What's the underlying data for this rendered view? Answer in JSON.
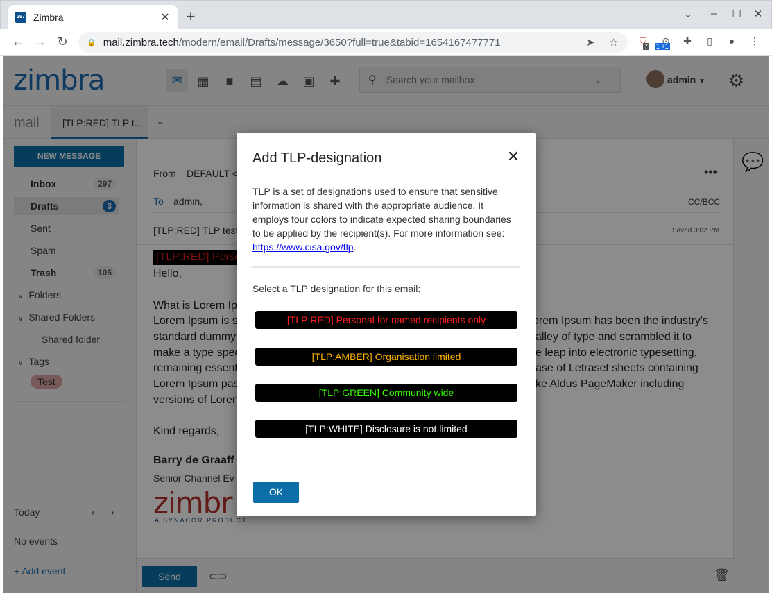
{
  "browser": {
    "tab_title": "Zimbra",
    "url_host": "mail.zimbra.tech",
    "url_path": "/modern/email/Drafts/message/3650?full=true&tabid=1654167477771",
    "ext_badge_1": "7",
    "ext_badge_2": "1 +1",
    "favicon_text": "297"
  },
  "app": {
    "logo": "zimbra",
    "search_placeholder": "Search your mailbox",
    "username": "admin",
    "tab_mail": "mail",
    "tab_draft": "[TLP:RED] TLP t..."
  },
  "sidebar": {
    "new_message": "NEW MESSAGE",
    "folders": [
      {
        "label": "Inbox",
        "count": "297",
        "bold": true
      },
      {
        "label": "Drafts",
        "count": "3",
        "bold": true
      },
      {
        "label": "Sent",
        "count": ""
      },
      {
        "label": "Spam",
        "count": ""
      },
      {
        "label": "Trash",
        "count": "105",
        "bold": true
      }
    ],
    "folders_group": "Folders",
    "shared_group": "Shared Folders",
    "shared_folder": "Shared folder",
    "tags_group": "Tags",
    "tag": "Test",
    "today": "Today",
    "no_events": "No events",
    "add_event": "Add event"
  },
  "compose": {
    "from_label": "From",
    "from_value": "DEFAULT <a",
    "to_label": "To",
    "to_value": "admin,",
    "ccbcc": "CC/BCC",
    "subject": "[TLP:RED] TLP test",
    "saved": "Saved 3:02 PM",
    "tlp_tag": "[TLP:RED] Perso",
    "greeting": "Hello,",
    "line1": "What is Lorem Ip",
    "para_left": [
      "Lorem Ipsum is s",
      "standard dummy",
      "make a type spec",
      "remaining essent",
      "Lorem Ipsum pas",
      "versions of Loren"
    ],
    "para_right": [
      "orem Ipsum has been the industry's",
      "alley of type and scrambled it to",
      "e leap into electronic typesetting,",
      "ase of Letraset sheets containing",
      "ke Aldus PageMaker including"
    ],
    "closing": "Kind regards,",
    "sig_name": "Barry de Graaff",
    "sig_title": "Senior Channel Ev",
    "sig_logo": "zimbr",
    "sig_sub": "A SYNACOR PRODUCT",
    "send": "Send"
  },
  "modal": {
    "title": "Add TLP-designation",
    "desc": "TLP is a set of designations used to ensure that sensitive information is shared with the appropriate audience. It employs four colors to indicate expected sharing boundaries to be applied by the recipient(s). For more information see: ",
    "link": "https://www.cisa.gov/tlp",
    "desc_end": ".",
    "prompt": "Select a TLP designation for this email:",
    "options": [
      {
        "label": "[TLP:RED] Personal for named recipients only",
        "color": "#ff2020"
      },
      {
        "label": "[TLP:AMBER] Organisation limited",
        "color": "#ffb200"
      },
      {
        "label": "[TLP:GREEN] Community wide",
        "color": "#33ff00"
      },
      {
        "label": "[TLP:WHITE] Disclosure is not limited",
        "color": "#ffffff"
      }
    ],
    "ok": "OK"
  }
}
